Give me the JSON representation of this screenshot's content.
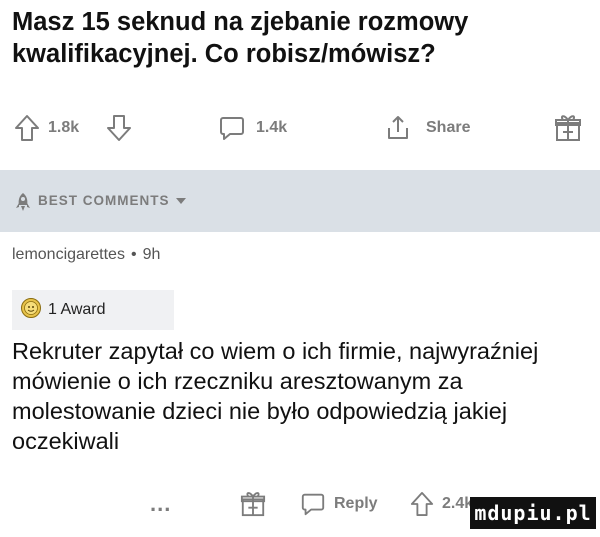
{
  "post": {
    "title": "Masz 15 seknud na zjebanie rozmowy kwalifikacyjnej. Co robisz/mówisz?",
    "upvotes": "1.8k",
    "comments": "1.4k",
    "share_label": "Share",
    "icons": [
      "upvote-icon",
      "downvote-icon",
      "comment-icon",
      "share-icon",
      "award-icon"
    ]
  },
  "best_comments": {
    "label": "BEST COMMENTS",
    "icons": [
      "rocket-icon",
      "caret-down-icon"
    ]
  },
  "comment": {
    "author": "lemoncigarettes",
    "separator": "•",
    "age": "9h",
    "award_label": "1 Award",
    "body": "Rekruter zapytał co wiem o ich firmie, najwyraźniej mówienie o ich rzeczniku aresztowanym za molestowanie dzieci nie było odpowiedzią jakiej oczekiwali",
    "more_label": "...",
    "reply_label": "Reply",
    "score": "2.4k"
  },
  "watermark": "mdupiu.pl",
  "colors": {
    "action_gray": "#7c7c7c",
    "band_bg": "#dae0e6",
    "award_bg": "#f0f1f3"
  }
}
